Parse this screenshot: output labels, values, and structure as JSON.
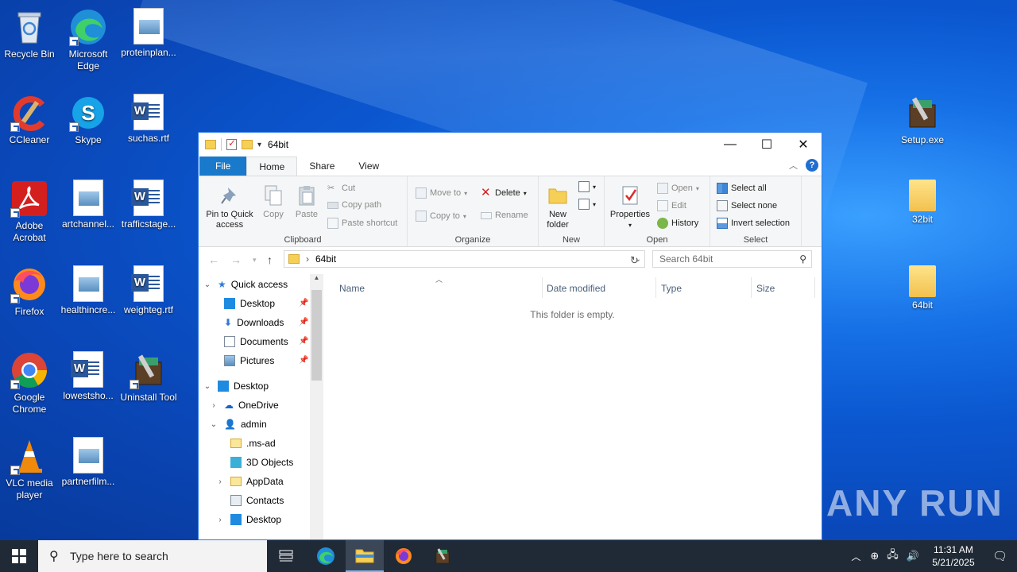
{
  "desktop": {
    "icons": [
      {
        "label": "Recycle Bin"
      },
      {
        "label": "Microsoft Edge"
      },
      {
        "label": "proteinplan..."
      },
      {
        "label": "CCleaner"
      },
      {
        "label": "Skype"
      },
      {
        "label": "suchas.rtf"
      },
      {
        "label": "Adobe Acrobat"
      },
      {
        "label": "artchannel..."
      },
      {
        "label": "trafficstage..."
      },
      {
        "label": "Firefox"
      },
      {
        "label": "healthincre..."
      },
      {
        "label": "weighteg.rtf"
      },
      {
        "label": "Google Chrome"
      },
      {
        "label": "lowestsho..."
      },
      {
        "label": "Uninstall Tool"
      },
      {
        "label": "VLC media player"
      },
      {
        "label": "partnerfilm..."
      },
      {
        "label": "Setup.exe"
      },
      {
        "label": "32bit"
      },
      {
        "label": "64bit"
      }
    ],
    "watermark": "ANY RUN"
  },
  "explorer": {
    "title": "64bit",
    "tabs": [
      "File",
      "Home",
      "Share",
      "View"
    ],
    "ribbon": {
      "clipboard": {
        "pin_to_quick_access": "Pin to Quick access",
        "copy": "Copy",
        "paste": "Paste",
        "cut": "Cut",
        "copy_path": "Copy path",
        "paste_shortcut": "Paste shortcut",
        "label": "Clipboard"
      },
      "organize": {
        "move_to": "Move to",
        "copy_to": "Copy to",
        "delete": "Delete",
        "rename": "Rename",
        "label": "Organize"
      },
      "new": {
        "new_folder": "New folder",
        "label": "New"
      },
      "open": {
        "properties": "Properties",
        "open": "Open",
        "edit": "Edit",
        "history": "History",
        "label": "Open"
      },
      "select": {
        "select_all": "Select all",
        "select_none": "Select none",
        "invert_selection": "Invert selection",
        "label": "Select"
      }
    },
    "address": {
      "path": "64bit",
      "search_placeholder": "Search 64bit"
    },
    "nav": {
      "quick_access": "Quick access",
      "qa_items": [
        "Desktop",
        "Downloads",
        "Documents",
        "Pictures"
      ],
      "desktop": "Desktop",
      "onedrive": "OneDrive",
      "admin": "admin",
      "admin_items": [
        ".ms-ad",
        "3D Objects",
        "AppData",
        "Contacts",
        "Desktop"
      ]
    },
    "columns": [
      "Name",
      "Date modified",
      "Type",
      "Size"
    ],
    "empty_message": "This folder is empty."
  },
  "taskbar": {
    "search_placeholder": "Type here to search",
    "time": "11:31 AM",
    "date": "5/21/2025"
  }
}
